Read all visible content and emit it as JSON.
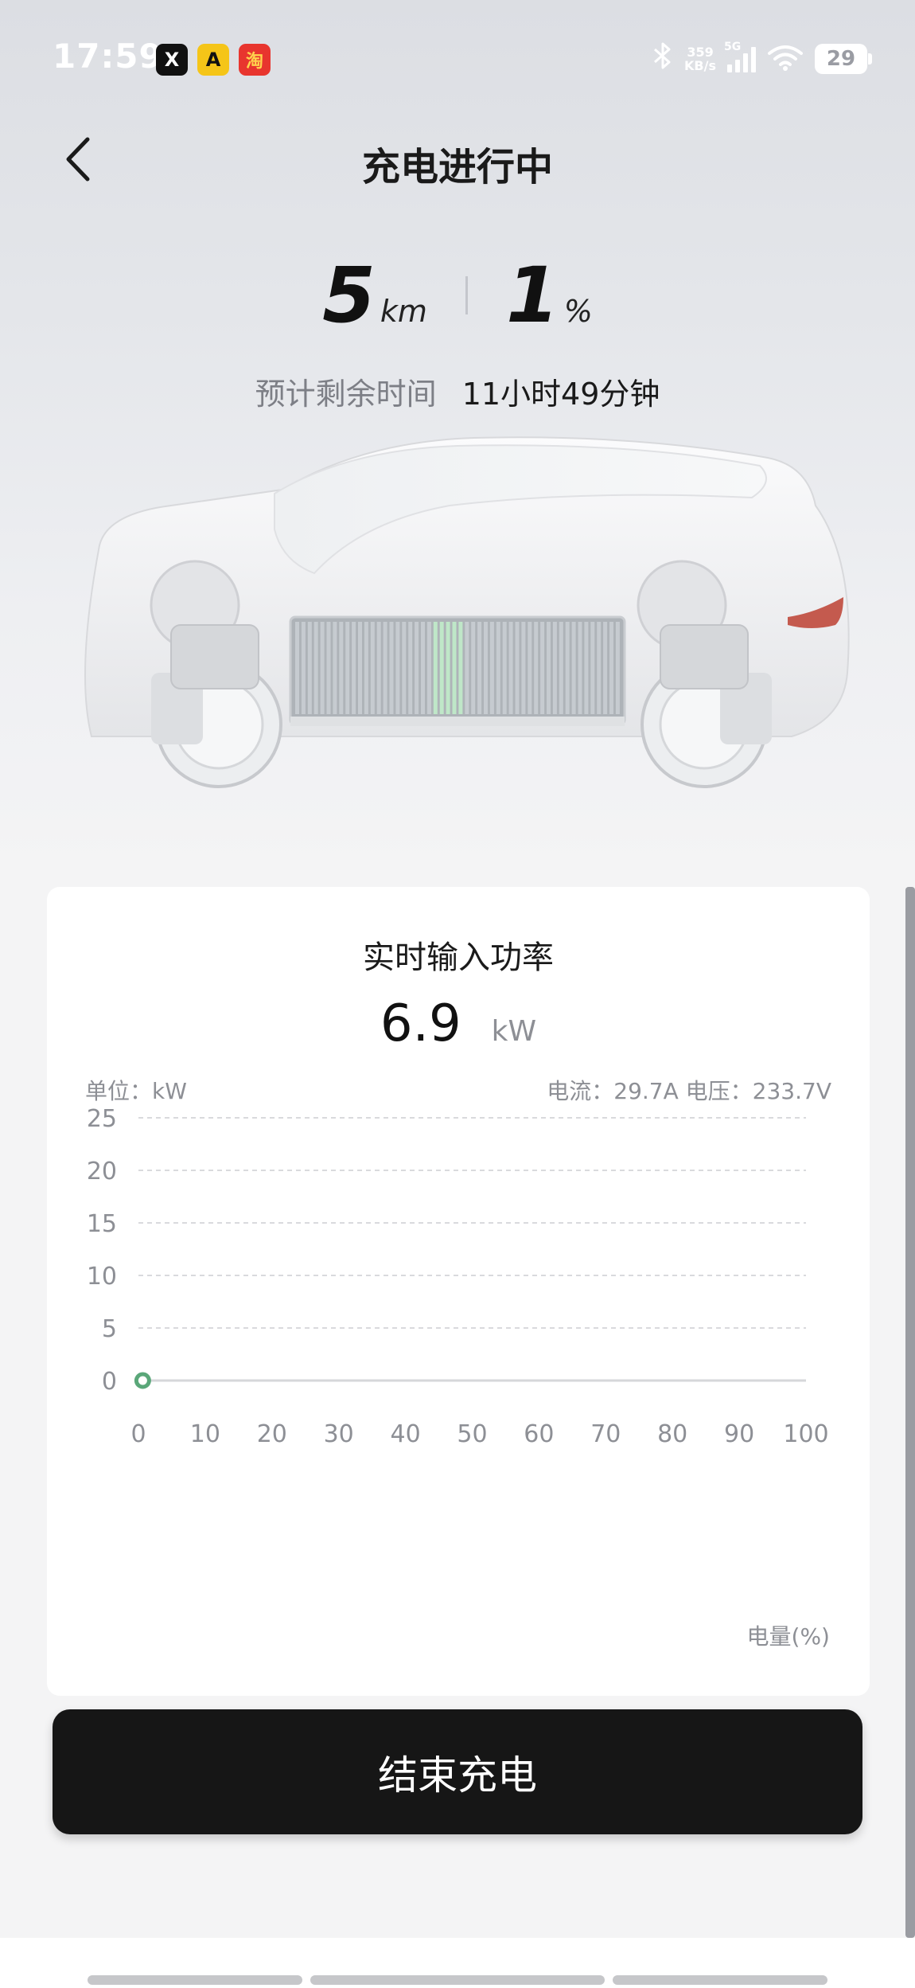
{
  "status_bar": {
    "time": "17:59",
    "app_icons": [
      "X",
      "A",
      "淘"
    ],
    "net_speed_value": "359",
    "net_speed_unit": "KB/s",
    "network_type": "5G",
    "battery_level": "29"
  },
  "header": {
    "title": "充电进行中"
  },
  "stats": {
    "range_value": "5",
    "range_unit": "km",
    "soc_value": "1",
    "soc_unit": "%"
  },
  "eta": {
    "label": "预计剩余时间",
    "value": "11小时49分钟"
  },
  "power_card": {
    "title": "实时输入功率",
    "power_value": "6.9",
    "power_unit": "kW",
    "unit_label": "单位：kW",
    "current_voltage": "电流：29.7A   电压：233.7V"
  },
  "chart_data": {
    "type": "line",
    "title": "",
    "ylabel": "",
    "xlabel": "电量(%)",
    "x_ticks": [
      0,
      10,
      20,
      30,
      40,
      50,
      60,
      70,
      80,
      90,
      100
    ],
    "y_ticks": [
      0,
      5,
      10,
      15,
      20,
      25
    ],
    "xlim": [
      0,
      100
    ],
    "ylim": [
      0,
      25
    ],
    "grid": true,
    "series": [
      {
        "x": [
          1
        ],
        "y": [
          0
        ]
      }
    ],
    "colors": {
      "point": "#5aa779",
      "grid": "#d9dadd",
      "axis": "#d6d7da"
    }
  },
  "actions": {
    "end_charging": "结束充电"
  }
}
